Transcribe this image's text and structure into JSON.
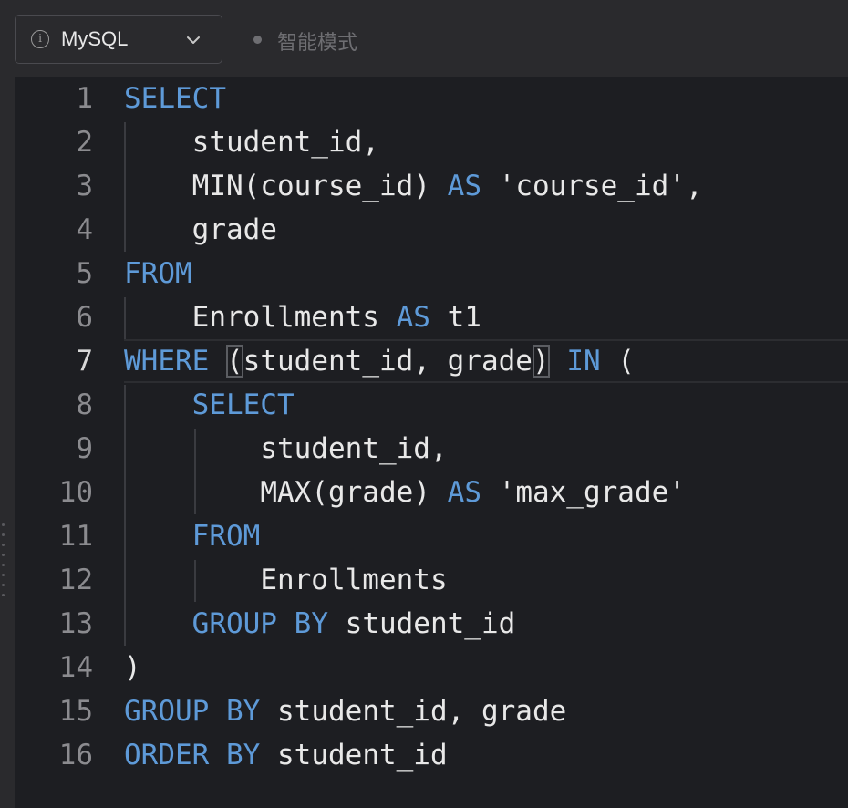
{
  "toolbar": {
    "language": "MySQL",
    "info_icon": "info-icon",
    "dropdown_icon": "chevron-down-icon",
    "mode_label": "智能模式"
  },
  "colors": {
    "keyword": "#5e9ad8",
    "text": "#e8e8e8",
    "line_number": "#8b8b8f",
    "editor_bg": "#1d1e22"
  },
  "editor": {
    "active_line": 7,
    "lines": [
      {
        "num": "1",
        "text": "SELECT"
      },
      {
        "num": "2",
        "text": "    student_id,"
      },
      {
        "num": "3",
        "text": "    MIN(course_id) AS 'course_id',"
      },
      {
        "num": "4",
        "text": "    grade"
      },
      {
        "num": "5",
        "text": "FROM"
      },
      {
        "num": "6",
        "text": "    Enrollments AS t1"
      },
      {
        "num": "7",
        "text": "WHERE (student_id, grade) IN ("
      },
      {
        "num": "8",
        "text": "    SELECT"
      },
      {
        "num": "9",
        "text": "        student_id,"
      },
      {
        "num": "10",
        "text": "        MAX(grade) AS 'max_grade'"
      },
      {
        "num": "11",
        "text": "    FROM"
      },
      {
        "num": "12",
        "text": "        Enrollments"
      },
      {
        "num": "13",
        "text": "    GROUP BY student_id"
      },
      {
        "num": "14",
        "text": ")"
      },
      {
        "num": "15",
        "text": "GROUP BY student_id, grade"
      },
      {
        "num": "16",
        "text": "ORDER BY student_id"
      }
    ]
  }
}
